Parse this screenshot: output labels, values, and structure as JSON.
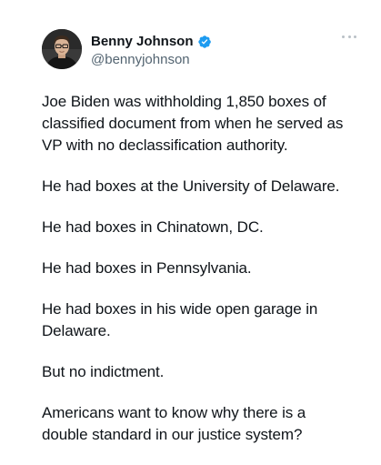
{
  "author": {
    "name": "Benny Johnson",
    "handle": "@bennyjohnson",
    "verified": true,
    "verified_color": "#1d9bf0"
  },
  "menu": {
    "icon": "more-horizontal-icon"
  },
  "tweet": {
    "paragraphs": [
      "Joe Biden was withholding 1,850 boxes of classified document from when he served as VP with no declassification authority.",
      "He had boxes at the University of Delaware.",
      "He had boxes in Chinatown, DC.",
      "He had boxes in Pennsylvania.",
      "He had boxes in his wide open garage in Delaware.",
      "But no indictment.",
      "Americans want to know why there is a double standard in our justice system?"
    ]
  }
}
